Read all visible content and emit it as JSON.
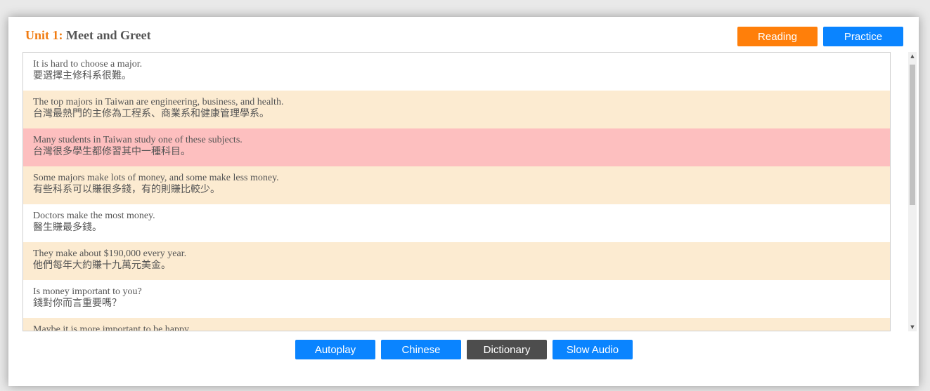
{
  "header": {
    "unit_label": "Unit 1:",
    "title": "Meet and Greet"
  },
  "top_buttons": {
    "reading": "Reading",
    "practice": "Practice"
  },
  "sentences": [
    {
      "en": "It is hard to choose a major.",
      "zh": "要選擇主修科系很難。",
      "style": "white"
    },
    {
      "en": "The top majors in Taiwan are engineering, business, and health.",
      "zh": "台灣最熱門的主修為工程系、商業系和健康管理學系。",
      "style": "cream"
    },
    {
      "en": "Many students in Taiwan study one of these subjects.",
      "zh": "台灣很多學生都修習其中一種科目。",
      "style": "pink"
    },
    {
      "en": "Some majors make lots of money, and some make less money.",
      "zh": "有些科系可以賺很多錢，有的則賺比較少。",
      "style": "cream"
    },
    {
      "en": "Doctors make the most money.",
      "zh": "醫生賺最多錢。",
      "style": "white"
    },
    {
      "en": "They make about $190,000 every year.",
      "zh": "他們每年大約賺十九萬元美金。",
      "style": "cream"
    },
    {
      "en": "Is money important to you?",
      "zh": "錢對你而言重要嗎？",
      "style": "white"
    },
    {
      "en": "Maybe it is more important to be happy.",
      "zh": "",
      "style": "cream"
    }
  ],
  "bottom_buttons": {
    "autoplay": "Autoplay",
    "chinese": "Chinese",
    "dictionary": "Dictionary",
    "slow_audio": "Slow Audio"
  },
  "colors": {
    "accent_orange": "#ff7f0a",
    "accent_blue": "#0a84ff",
    "dark_button": "#4d4d4d",
    "highlight_row": "#fdbfbf",
    "alt_row": "#fcebd1"
  },
  "icons": {
    "scroll_up": "▲",
    "scroll_down": "▼"
  }
}
